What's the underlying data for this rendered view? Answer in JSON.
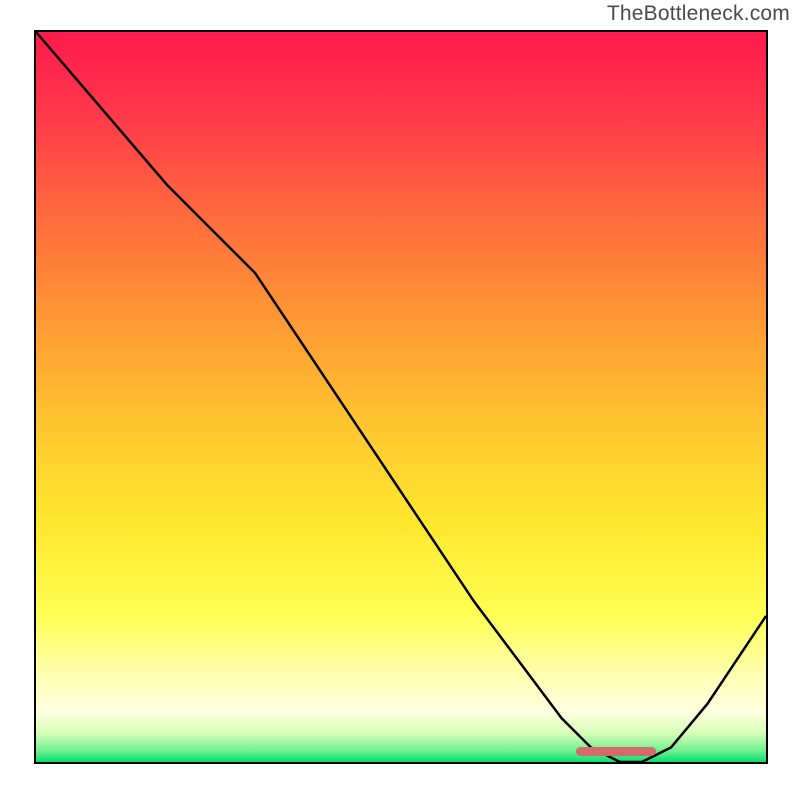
{
  "watermark": "TheBottleneck.com",
  "chart_data": {
    "type": "line",
    "title": "",
    "xlabel": "",
    "ylabel": "",
    "xlim": [
      0,
      100
    ],
    "ylim": [
      0,
      100
    ],
    "grid": false,
    "curve": {
      "x": [
        0,
        6,
        12,
        18,
        24,
        30,
        36,
        42,
        48,
        54,
        60,
        66,
        72,
        76,
        80,
        83,
        87,
        92,
        100
      ],
      "y": [
        100,
        93,
        86,
        79,
        73,
        67,
        58,
        49,
        40,
        31,
        22,
        14,
        6,
        2,
        0,
        0,
        2,
        8,
        20
      ]
    },
    "optimal_marker": {
      "x_start": 74,
      "x_end": 85,
      "y": 0.8
    },
    "gradient_stops": [
      {
        "offset": 0.0,
        "color": "#ff1a4d"
      },
      {
        "offset": 0.12,
        "color": "#ff3a4a"
      },
      {
        "offset": 0.25,
        "color": "#ff6a3d"
      },
      {
        "offset": 0.4,
        "color": "#ff9a34"
      },
      {
        "offset": 0.55,
        "color": "#ffc92f"
      },
      {
        "offset": 0.68,
        "color": "#ffe92f"
      },
      {
        "offset": 0.8,
        "color": "#ffff55"
      },
      {
        "offset": 0.88,
        "color": "#ffffb0"
      },
      {
        "offset": 0.93,
        "color": "#ffffe0"
      },
      {
        "offset": 0.96,
        "color": "#d8ffb8"
      },
      {
        "offset": 0.985,
        "color": "#70f090"
      },
      {
        "offset": 1.0,
        "color": "#00e070"
      }
    ]
  }
}
